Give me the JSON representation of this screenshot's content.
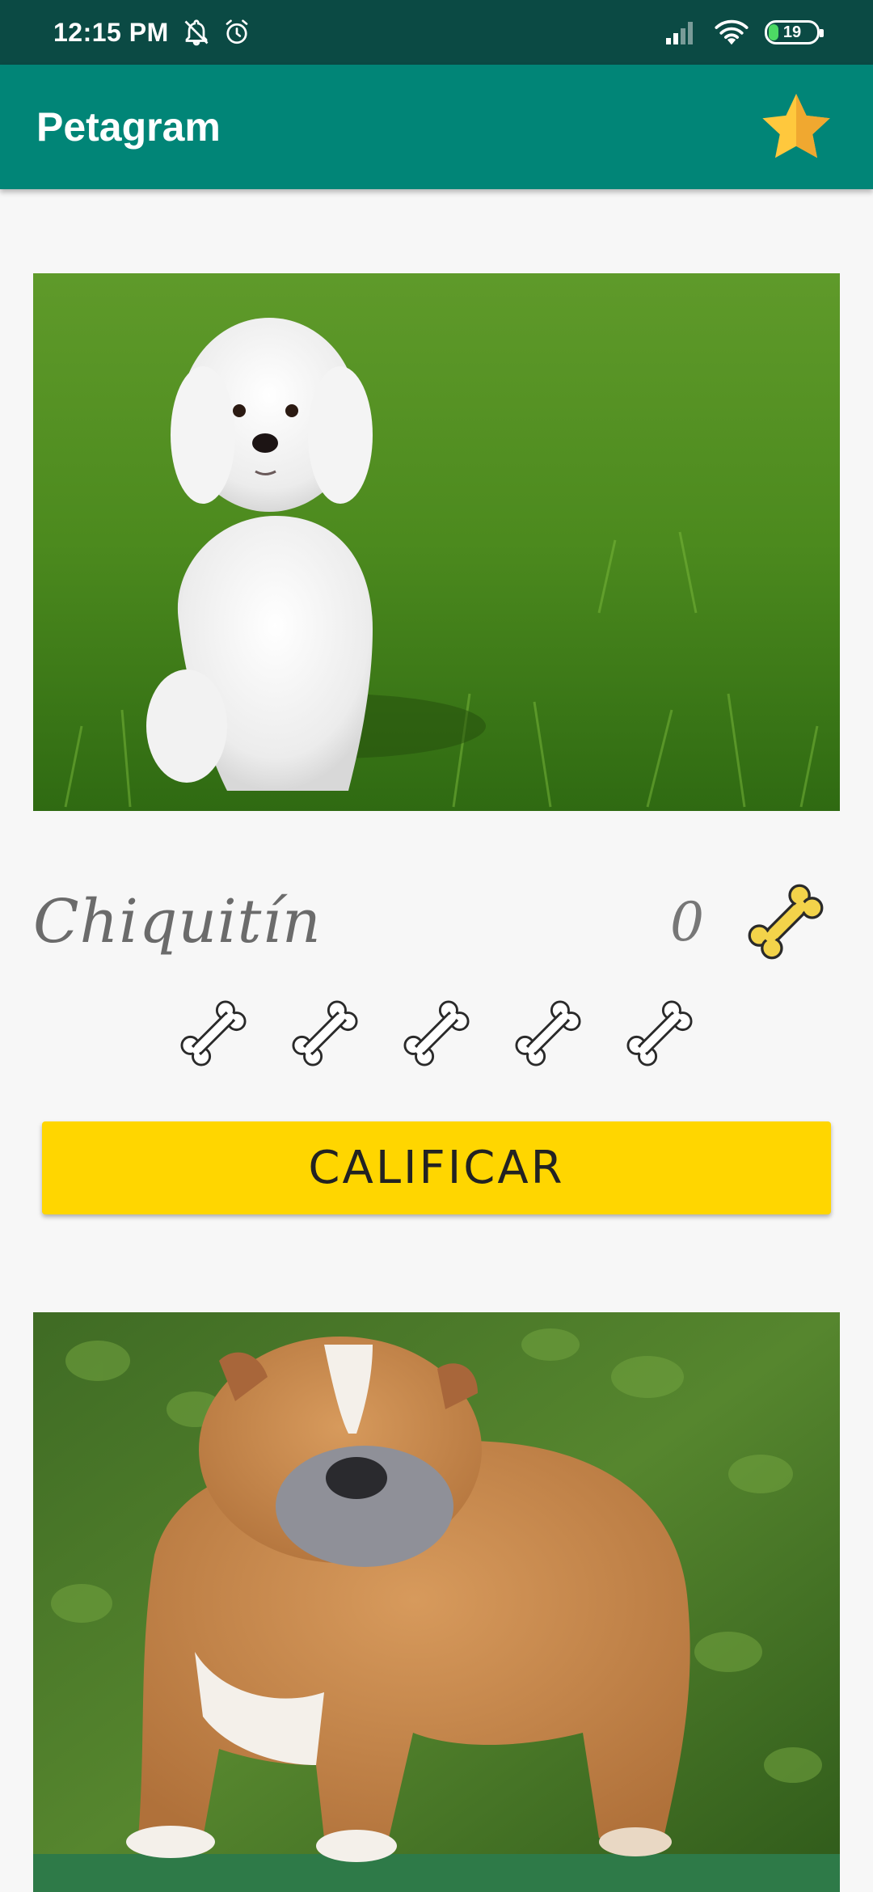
{
  "status_bar": {
    "time": "12:15 PM",
    "battery_level": "19",
    "icons": [
      "notifications-off-icon",
      "alarm-icon",
      "signal-icon",
      "wifi-icon",
      "battery-icon"
    ]
  },
  "app_bar": {
    "title": "Petagram",
    "action_icon": "star-icon"
  },
  "pets": [
    {
      "name": "Chiquitín",
      "rating_count": "0",
      "photo": "white-maltese-dog-photo"
    },
    {
      "photo": "english-bulldog-photo"
    }
  ],
  "rating": {
    "bones_total": 5,
    "bones_filled": 0,
    "button_label": "CALIFICAR"
  },
  "colors": {
    "status_bar": "#0b4a44",
    "app_bar": "#018577",
    "accent_button": "#ffd600",
    "star": "#ffc107",
    "bone_gold": "#f3d34a"
  }
}
